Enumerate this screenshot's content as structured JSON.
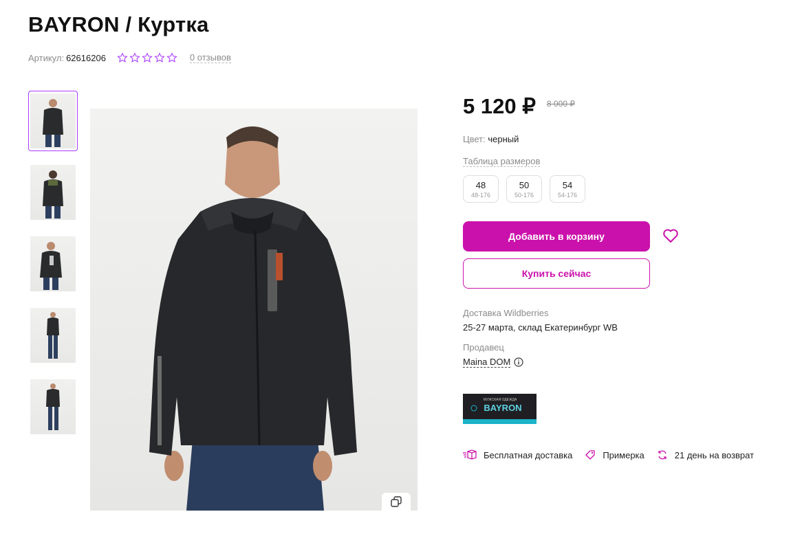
{
  "product": {
    "title": "BAYRON / Куртка",
    "article_label": "Артикул:",
    "article_value": "62616206",
    "rating_stars": 0,
    "reviews": "0 отзывов"
  },
  "gallery": {
    "thumbnail_count": 5,
    "active_index": 0
  },
  "price": {
    "current": "5 120 ₽",
    "old": "8 000 ₽"
  },
  "color": {
    "label": "Цвет:",
    "value": "черный"
  },
  "size_table_link": "Таблица размеров",
  "sizes": [
    {
      "main": "48",
      "sub": "48-176"
    },
    {
      "main": "50",
      "sub": "50-176"
    },
    {
      "main": "54",
      "sub": "54-176"
    }
  ],
  "actions": {
    "add_to_cart": "Добавить в корзину",
    "buy_now": "Купить сейчас"
  },
  "delivery": {
    "label": "Доставка Wildberries",
    "value": "25-27 марта, склад Екатеринбург WB"
  },
  "seller": {
    "label": "Продавец",
    "name": "Maina DOM"
  },
  "brand_logo": {
    "top_text": "МУЖСКАЯ ОДЕЖДА",
    "name": "BAYRON"
  },
  "features": [
    {
      "icon": "box-icon",
      "label": "Бесплатная доставка"
    },
    {
      "icon": "tag-icon",
      "label": "Примерка"
    },
    {
      "icon": "return-arrows-icon",
      "label": "21 день на возврат"
    }
  ],
  "colors": {
    "accent": "#cb11ab",
    "star": "#a73afd",
    "muted": "#8b8b8b"
  }
}
